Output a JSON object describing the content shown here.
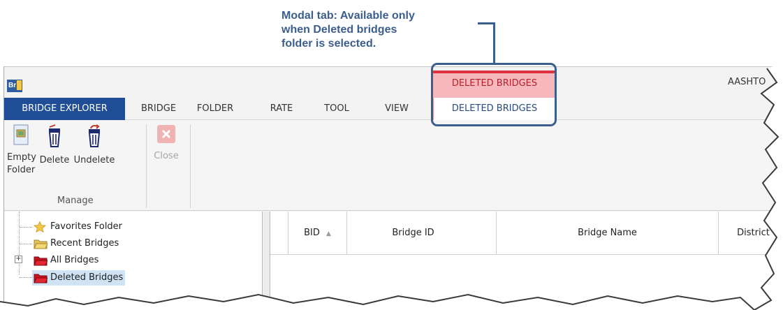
{
  "callout": {
    "text": "Modal tab: Available only\nwhen Deleted bridges\nfolder is selected."
  },
  "window": {
    "app_logo": "Br",
    "app_title": "AASHTO"
  },
  "contextual_group": {
    "header": "DELETED BRIDGES",
    "color": "#e0313f"
  },
  "tabs": [
    {
      "label": "BRIDGE EXPLORER"
    },
    {
      "label": "BRIDGE"
    },
    {
      "label": "FOLDER"
    },
    {
      "label": "RATE"
    },
    {
      "label": "TOOL"
    },
    {
      "label": "VIEW"
    },
    {
      "label": "DELETED BRIDGES"
    }
  ],
  "ribbon": {
    "buttons": [
      {
        "label": "Empty\nFolder",
        "icon": "empty-folder-icon"
      },
      {
        "label": "Delete",
        "icon": "delete-bin-icon"
      },
      {
        "label": "Undelete",
        "icon": "undelete-bin-icon"
      },
      {
        "label": "Close",
        "icon": "close-icon",
        "disabled": true
      }
    ],
    "group_label": "Manage"
  },
  "tree": {
    "items": [
      {
        "label": "Favorites Folder",
        "icon": "star-icon"
      },
      {
        "label": "Recent Bridges",
        "icon": "folder-icon"
      },
      {
        "label": "All Bridges",
        "icon": "red-folder-icon"
      },
      {
        "label": "Deleted Bridges",
        "icon": "red-folder-icon",
        "selected": true
      }
    ]
  },
  "grid": {
    "columns": [
      {
        "label": "BID",
        "sort_icon": "sort-ascending-icon"
      },
      {
        "label": "Bridge ID"
      },
      {
        "label": "Bridge Name"
      },
      {
        "label": "District"
      }
    ]
  },
  "colors": {
    "accent": "#1f4e96",
    "callout": "#3c5e8c",
    "contextual_fill": "#f6b8bc"
  }
}
